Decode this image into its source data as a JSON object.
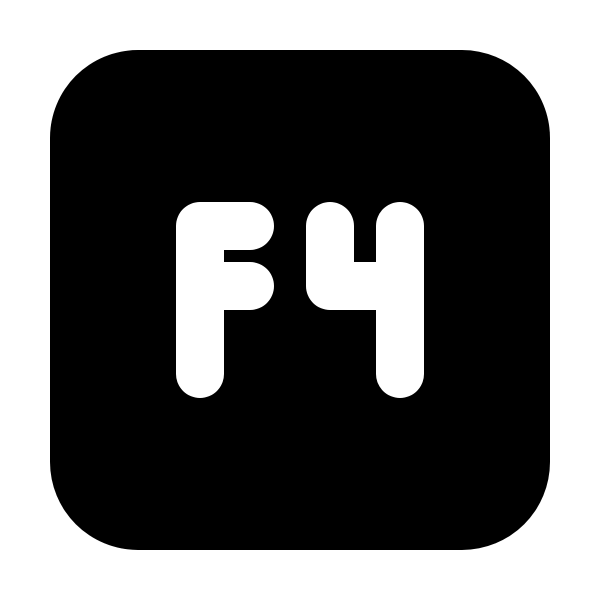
{
  "icon": {
    "name": "f4-key-icon",
    "label": "F4",
    "background_color": "#000000",
    "glyph_color": "#ffffff",
    "page_color": "#ffffff"
  }
}
